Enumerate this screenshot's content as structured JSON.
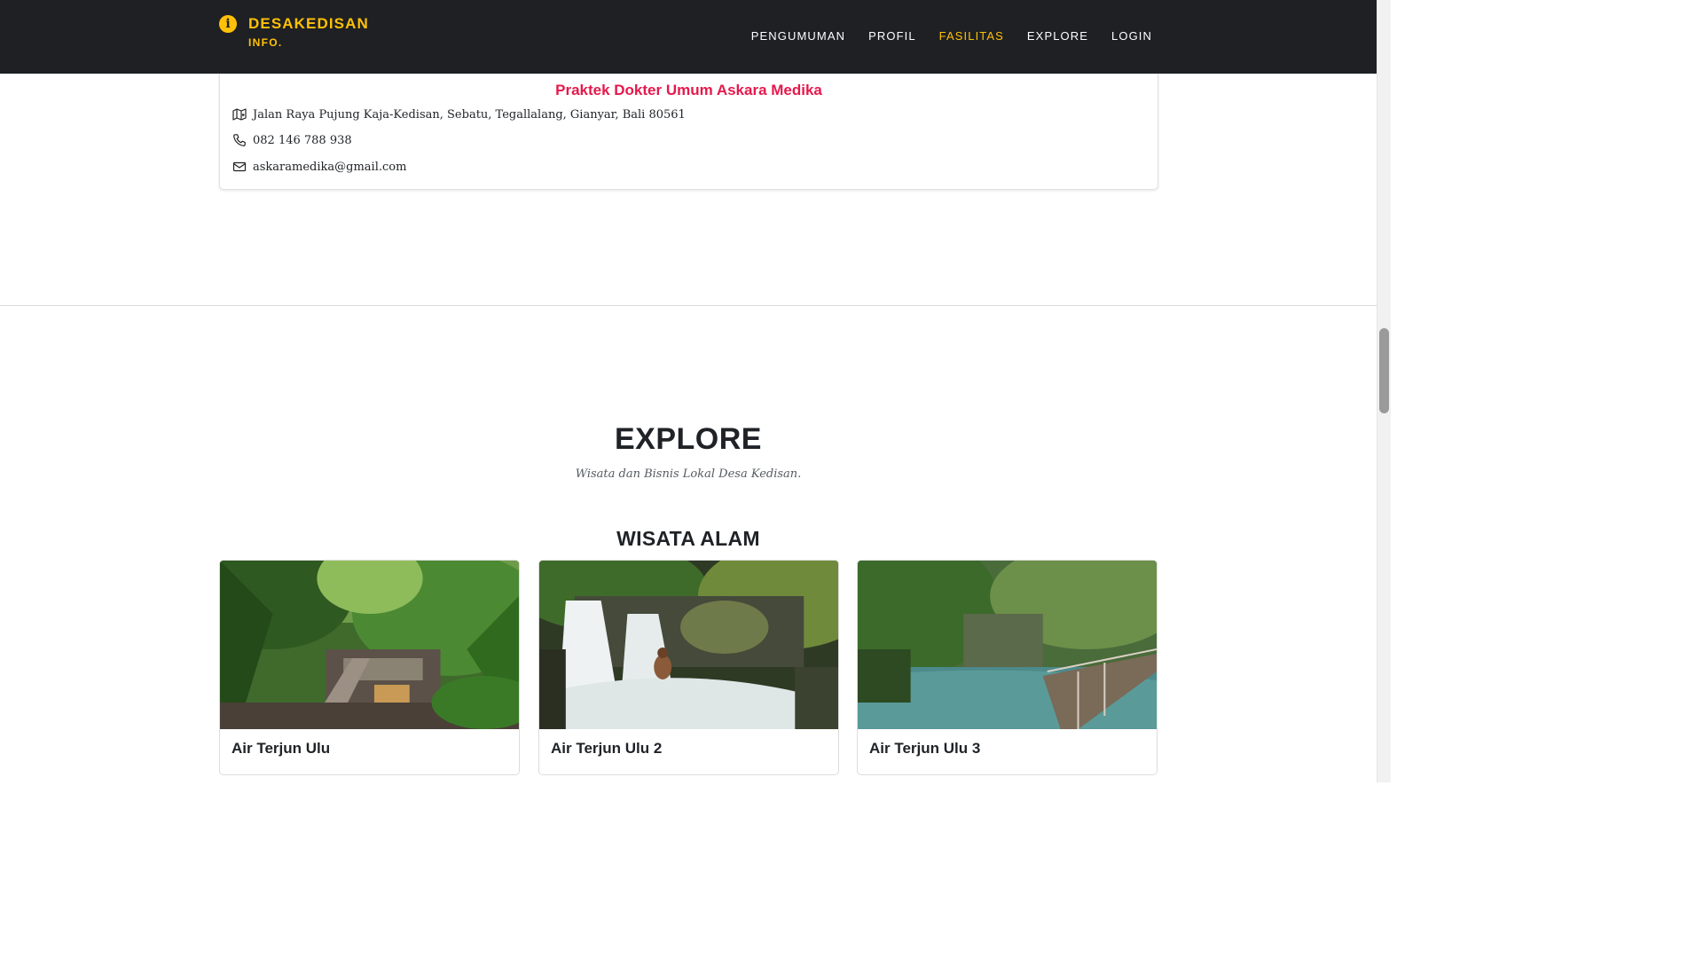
{
  "header": {
    "logo_title": "DESAKEDISAN",
    "logo_sub": "INFO.",
    "nav": [
      "PENGUMUMAN",
      "PROFIL",
      "FASILITAS",
      "EXPLORE",
      "LOGIN"
    ],
    "active_nav": "FASILITAS",
    "accent": "#ffc107",
    "background": "#1e2023"
  },
  "facility": {
    "name": "Praktek Dokter Umum Askara Medika",
    "address": "Jalan Raya Pujung Kaja-Kedisan, Sebatu, Tegallalang, Gianyar, Bali 80561",
    "phone": "082 146 788 938",
    "email": "askaramedika@gmail.com",
    "title_color": "#e5194c"
  },
  "explore": {
    "title": "EXPLORE",
    "subtitle": "Wisata dan Bisnis Lokal Desa Kedisan.",
    "section_title": "WISATA ALAM",
    "cards": [
      {
        "title": "Air Terjun Ulu",
        "photo_icon": "jungle-temple-photo"
      },
      {
        "title": "Air Terjun Ulu 2",
        "photo_icon": "waterfall-photo"
      },
      {
        "title": "Air Terjun Ulu 3",
        "photo_icon": "river-boardwalk-photo"
      }
    ]
  }
}
